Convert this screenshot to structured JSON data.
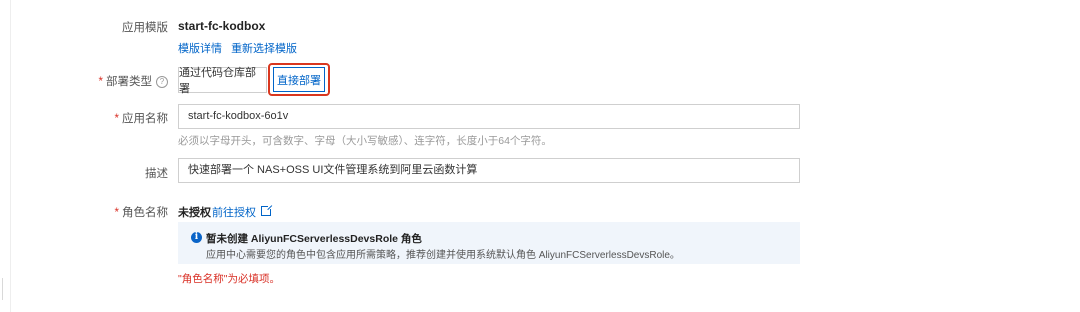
{
  "template": {
    "label": "应用模版",
    "name": "start-fc-kodbox",
    "details_link": "模版详情",
    "reselect_link": "重新选择模版"
  },
  "deploy_type": {
    "required_mark": "*",
    "label": "部署类型",
    "help_icon": "question-circle-icon",
    "option_code": "通过代码仓库部署",
    "option_direct": "直接部署",
    "selected": "直接部署"
  },
  "app_name": {
    "required_mark": "*",
    "label": "应用名称",
    "value": "start-fc-kodbox-6o1v",
    "hint": "必须以字母开头，可含数字、字母（大小写敏感）、连字符，长度小于64个字符。"
  },
  "description": {
    "label": "描述",
    "value": "快速部署一个 NAS+OSS UI文件管理系统到阿里云函数计算"
  },
  "role": {
    "required_mark": "*",
    "label": "角色名称",
    "status": "未授权",
    "authorize_link": "前往授权",
    "link_icon": "external-link-icon",
    "notice_icon": "info-icon",
    "notice_title": "暂未创建 AliyunFCServerlessDevsRole 角色",
    "notice_body": "应用中心需要您的角色中包含应用所需策略，推荐创建并使用系统默认角色 AliyunFCServerlessDevsRole。",
    "error": "\"角色名称\"为必填项。"
  },
  "colors": {
    "link": "#0064c8",
    "highlight_box": "#d9371f",
    "required": "#d93026",
    "notice_bg": "#f0f5fb"
  }
}
